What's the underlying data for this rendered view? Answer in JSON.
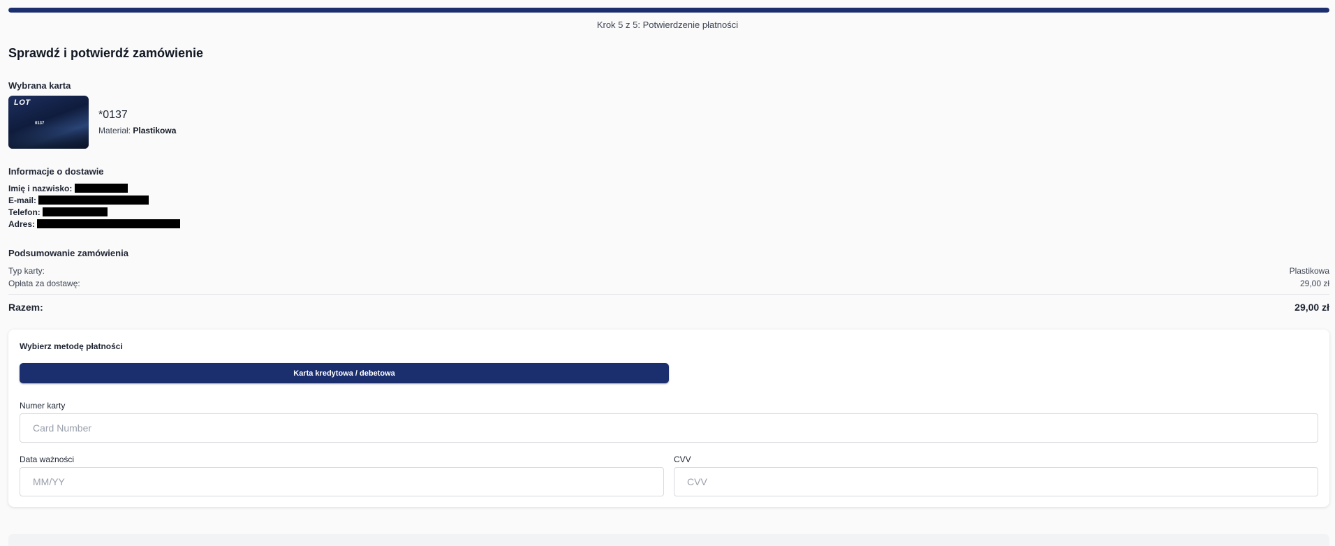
{
  "progress": {
    "fraction": 1.0,
    "color": "#1b2f6e"
  },
  "step_text": "Krok 5 z 5: Potwierdzenie płatności",
  "page_title": "Sprawdź i potwierdź zamówienie",
  "selected_card": {
    "section_title": "Wybrana karta",
    "logo_text": "LOT",
    "card_digits": "0137",
    "number": "*0137",
    "material_label": "Materiał:",
    "material_value": "Plastikowa"
  },
  "delivery": {
    "section_title": "Informacje o dostawie",
    "name_label": "Imię i nazwisko:",
    "email_label": "E-mail:",
    "phone_label": "Telefon:",
    "address_label": "Adres:"
  },
  "summary": {
    "section_title": "Podsumowanie zamówienia",
    "rows": [
      {
        "label": "Typ karty:",
        "value": "Plastikowa"
      },
      {
        "label": "Opłata za dostawę:",
        "value": "29,00 zł"
      }
    ],
    "total_label": "Razem:",
    "total_value": "29,00 zł"
  },
  "payment": {
    "title": "Wybierz metodę płatności",
    "method_button": "Karta kredytowa / debetowa",
    "card_number_label": "Numer karty",
    "card_number_placeholder": "Card Number",
    "expiry_label": "Data ważności",
    "expiry_placeholder": "MM/YY",
    "cvv_label": "CVV",
    "cvv_placeholder": "CVV"
  },
  "colors": {
    "accent": "#1b2f6e",
    "background": "#fafafa"
  }
}
